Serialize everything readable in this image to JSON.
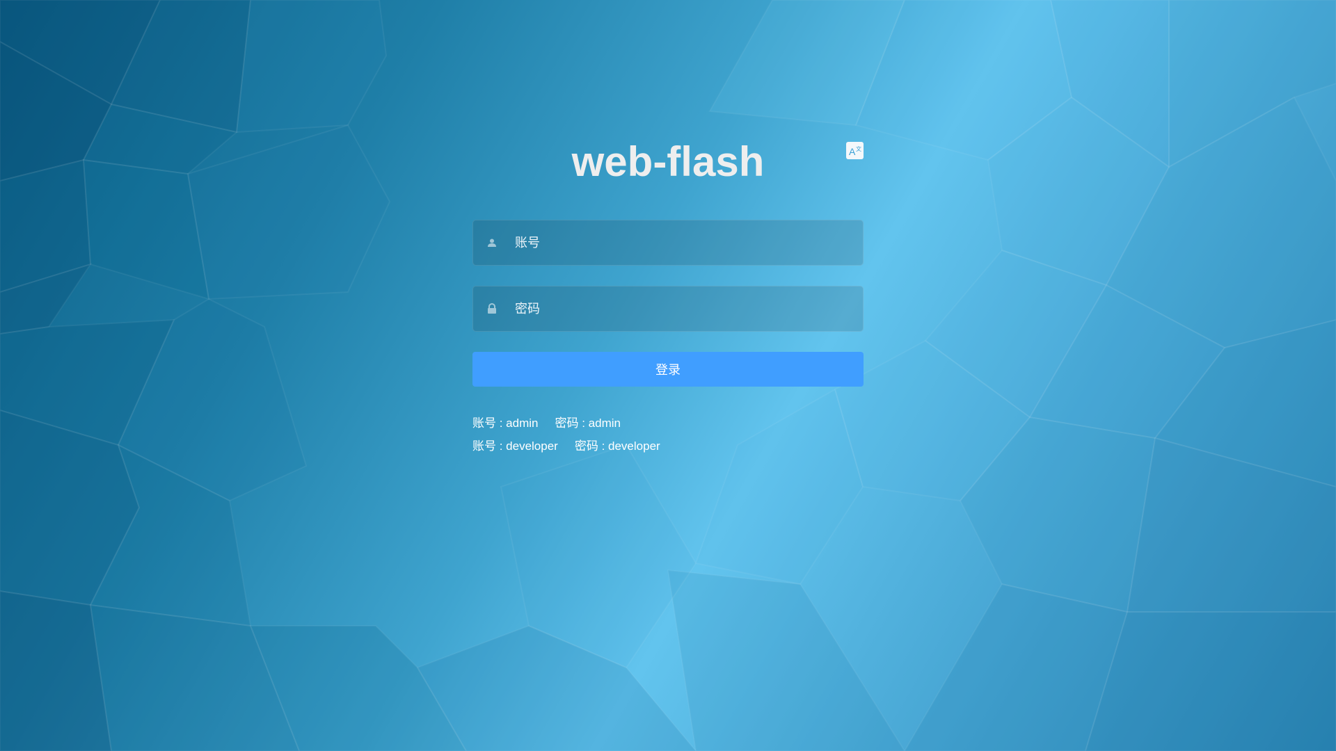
{
  "app": {
    "title": "web-flash"
  },
  "language_switch": {
    "icon": "translate-icon"
  },
  "login_form": {
    "username": {
      "icon": "user-icon",
      "placeholder": "账号",
      "value": ""
    },
    "password": {
      "icon": "lock-icon",
      "placeholder": "密码",
      "value": ""
    },
    "submit_label": "登录"
  },
  "tips": [
    {
      "account": "账号 : admin",
      "password": "密码 : admin"
    },
    {
      "account": "账号 : developer",
      "password": "密码 : developer"
    }
  ],
  "colors": {
    "button": "#409eff",
    "title": "#eeeeee",
    "background_dark": "#0c5f86",
    "background_light": "#62c4ee"
  }
}
